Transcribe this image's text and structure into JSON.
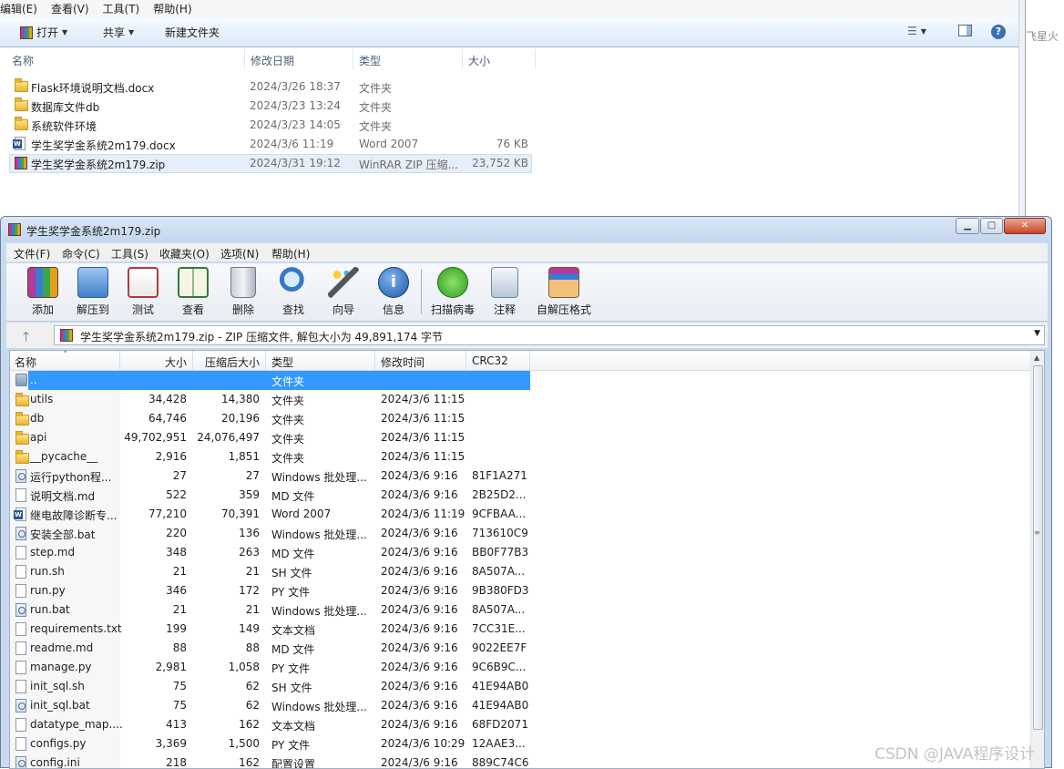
{
  "explorer": {
    "menu": [
      "编辑(E)",
      "查看(V)",
      "工具(T)",
      "帮助(H)"
    ],
    "toolbar": {
      "open": "打开",
      "share": "共享",
      "new_folder": "新建文件夹"
    },
    "columns": {
      "name": "名称",
      "modified": "修改日期",
      "type": "类型",
      "size": "大小"
    },
    "files": [
      {
        "name": "Flask环境说明文档.docx",
        "modified": "2024/3/26 18:37",
        "type": "文件夹",
        "size": "",
        "icon": "folder-icon"
      },
      {
        "name": "数据库文件db",
        "modified": "2024/3/23 13:24",
        "type": "文件夹",
        "size": "",
        "icon": "folder-icon"
      },
      {
        "name": "系统软件环境",
        "modified": "2024/3/23 14:05",
        "type": "文件夹",
        "size": "",
        "icon": "folder-icon"
      },
      {
        "name": "学生奖学金系统2m179.docx",
        "modified": "2024/3/6 11:19",
        "type": "Word 2007",
        "size": "76 KB",
        "icon": "word-doc-icon"
      },
      {
        "name": "学生奖学金系统2m179.zip",
        "modified": "2024/3/31 19:12",
        "type": "WinRAR ZIP 压缩...",
        "size": "23,752 KB",
        "icon": "zip-archive-icon"
      }
    ],
    "side_text": "飞星火"
  },
  "winrar": {
    "title": "学生奖学金系统2m179.zip",
    "menu": [
      "文件(F)",
      "命令(C)",
      "工具(S)",
      "收藏夹(O)",
      "选项(N)",
      "帮助(H)"
    ],
    "tools": [
      "添加",
      "解压到",
      "测试",
      "查看",
      "删除",
      "查找",
      "向导",
      "信息",
      "扫描病毒",
      "注释",
      "自解压格式"
    ],
    "address": "学生奖学金系统2m179.zip - ZIP 压缩文件, 解包大小为 49,891,174 字节",
    "columns": {
      "name": "名称",
      "size": "大小",
      "packed": "压缩后大小",
      "type": "类型",
      "modified": "修改时间",
      "crc": "CRC32"
    },
    "rows": [
      {
        "name": "..",
        "size": "",
        "packed": "",
        "type": "文件夹",
        "modified": "",
        "crc": "",
        "icon": "up-folder-icon"
      },
      {
        "name": "utils",
        "size": "34,428",
        "packed": "14,380",
        "type": "文件夹",
        "modified": "2024/3/6 11:15",
        "crc": "",
        "icon": "folder-icon"
      },
      {
        "name": "db",
        "size": "64,746",
        "packed": "20,196",
        "type": "文件夹",
        "modified": "2024/3/6 11:15",
        "crc": "",
        "icon": "folder-icon"
      },
      {
        "name": "api",
        "size": "49,702,951",
        "packed": "24,076,497",
        "type": "文件夹",
        "modified": "2024/3/6 11:15",
        "crc": "",
        "icon": "folder-icon"
      },
      {
        "name": "__pycache__",
        "size": "2,916",
        "packed": "1,851",
        "type": "文件夹",
        "modified": "2024/3/6 11:15",
        "crc": "",
        "icon": "folder-icon"
      },
      {
        "name": "运行python程...",
        "size": "27",
        "packed": "27",
        "type": "Windows 批处理...",
        "modified": "2024/3/6 9:16",
        "crc": "81F1A271",
        "icon": "batch-file-icon"
      },
      {
        "name": "说明文档.md",
        "size": "522",
        "packed": "359",
        "type": "MD 文件",
        "modified": "2024/3/6 9:16",
        "crc": "2B25D2...",
        "icon": "document-icon"
      },
      {
        "name": "继电故障诊断专...",
        "size": "77,210",
        "packed": "70,391",
        "type": "Word 2007",
        "modified": "2024/3/6 11:19",
        "crc": "9CFBAA...",
        "icon": "word-doc-icon"
      },
      {
        "name": "安装全部.bat",
        "size": "220",
        "packed": "136",
        "type": "Windows 批处理...",
        "modified": "2024/3/6 9:16",
        "crc": "713610C9",
        "icon": "batch-file-icon"
      },
      {
        "name": "step.md",
        "size": "348",
        "packed": "263",
        "type": "MD 文件",
        "modified": "2024/3/6 9:16",
        "crc": "BB0F77B3",
        "icon": "document-icon"
      },
      {
        "name": "run.sh",
        "size": "21",
        "packed": "21",
        "type": "SH 文件",
        "modified": "2024/3/6 9:16",
        "crc": "8A507A...",
        "icon": "document-icon"
      },
      {
        "name": "run.py",
        "size": "346",
        "packed": "172",
        "type": "PY 文件",
        "modified": "2024/3/6 9:16",
        "crc": "9B380FD3",
        "icon": "document-icon"
      },
      {
        "name": "run.bat",
        "size": "21",
        "packed": "21",
        "type": "Windows 批处理...",
        "modified": "2024/3/6 9:16",
        "crc": "8A507A...",
        "icon": "batch-file-icon"
      },
      {
        "name": "requirements.txt",
        "size": "199",
        "packed": "149",
        "type": "文本文档",
        "modified": "2024/3/6 9:16",
        "crc": "7CC31E...",
        "icon": "document-icon"
      },
      {
        "name": "readme.md",
        "size": "88",
        "packed": "88",
        "type": "MD 文件",
        "modified": "2024/3/6 9:16",
        "crc": "9022EE7F",
        "icon": "document-icon"
      },
      {
        "name": "manage.py",
        "size": "2,981",
        "packed": "1,058",
        "type": "PY 文件",
        "modified": "2024/3/6 9:16",
        "crc": "9C6B9C...",
        "icon": "document-icon"
      },
      {
        "name": "init_sql.sh",
        "size": "75",
        "packed": "62",
        "type": "SH 文件",
        "modified": "2024/3/6 9:16",
        "crc": "41E94AB0",
        "icon": "document-icon"
      },
      {
        "name": "init_sql.bat",
        "size": "75",
        "packed": "62",
        "type": "Windows 批处理...",
        "modified": "2024/3/6 9:16",
        "crc": "41E94AB0",
        "icon": "batch-file-icon"
      },
      {
        "name": "datatype_map....",
        "size": "413",
        "packed": "162",
        "type": "文本文档",
        "modified": "2024/3/6 9:16",
        "crc": "68FD2071",
        "icon": "document-icon"
      },
      {
        "name": "configs.py",
        "size": "3,369",
        "packed": "1,500",
        "type": "PY 文件",
        "modified": "2024/3/6 10:29",
        "crc": "12AAE3...",
        "icon": "document-icon"
      },
      {
        "name": "config.ini",
        "size": "218",
        "packed": "162",
        "type": "配置设置",
        "modified": "2024/3/6 9:16",
        "crc": "889C74C6",
        "icon": "settings-file-icon"
      }
    ]
  },
  "watermark": "CSDN @JAVA程序设计"
}
